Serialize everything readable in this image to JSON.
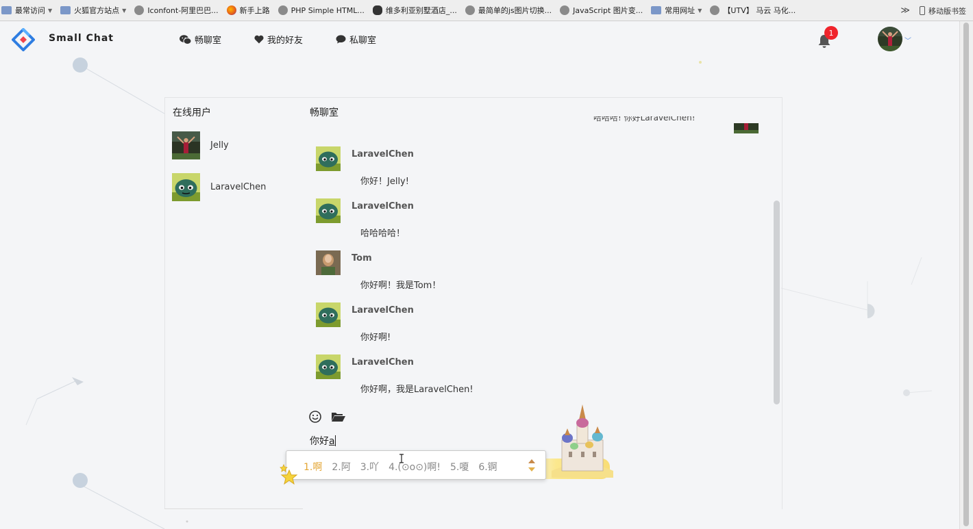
{
  "bookmarks": {
    "items": [
      {
        "label": "最常访问",
        "icon": "most-visited-icon",
        "caret": true
      },
      {
        "label": "火狐官方站点",
        "icon": "folder-icon",
        "caret": true
      },
      {
        "label": "Iconfont-阿里巴巴...",
        "icon": "globe-icon",
        "caret": false
      },
      {
        "label": "新手上路",
        "icon": "firefox-icon",
        "caret": false
      },
      {
        "label": "PHP Simple HTML...",
        "icon": "globe-icon",
        "caret": false
      },
      {
        "label": "维多利亚别墅酒店_...",
        "icon": "tripadvisor-icon",
        "caret": false
      },
      {
        "label": "最简单的js图片切换...",
        "icon": "globe-icon",
        "caret": false
      },
      {
        "label": "JavaScript 图片变...",
        "icon": "globe-icon",
        "caret": false
      },
      {
        "label": "常用网址",
        "icon": "folder-icon",
        "caret": true
      },
      {
        "label": "【UTV】 马云 马化...",
        "icon": "globe-icon",
        "caret": false
      }
    ],
    "more": "≫",
    "mobile": "移动版书签"
  },
  "header": {
    "brand": "Small Chat",
    "nav": [
      {
        "label": "畅聊室",
        "icon": "wechat-icon"
      },
      {
        "label": "我的好友",
        "icon": "heart-icon"
      },
      {
        "label": "私聊室",
        "icon": "comment-icon"
      }
    ],
    "notification_count": "1"
  },
  "online": {
    "title": "在线用户",
    "users": [
      {
        "name": "Jelly"
      },
      {
        "name": "LaravelChen"
      }
    ]
  },
  "chat": {
    "title": "畅聊室",
    "clipped_text": "哈哈哈! 你好LaravelChen!",
    "messages": [
      {
        "name": "LaravelChen",
        "text": "你好！Jelly!"
      },
      {
        "name": "LaravelChen",
        "text": "哈哈哈哈！"
      },
      {
        "name": "Tom",
        "text": "你好啊！我是Tom！"
      },
      {
        "name": "LaravelChen",
        "text": "你好啊!"
      },
      {
        "name": "LaravelChen",
        "text": "你好啊，我是LaravelChen!"
      }
    ]
  },
  "composer": {
    "typed": "你好",
    "composing": "a"
  },
  "ime": {
    "candidates": [
      "1.啊",
      "2.阿",
      "3.吖",
      "4.(⊙o⊙)啊!",
      "5.嗄",
      "6.锕"
    ],
    "active_index": 0
  },
  "colors": {
    "badge": "#f0242c",
    "ime_active": "#e3a533",
    "logo_blue": "#2f7de1",
    "logo_red": "#f0424b"
  }
}
